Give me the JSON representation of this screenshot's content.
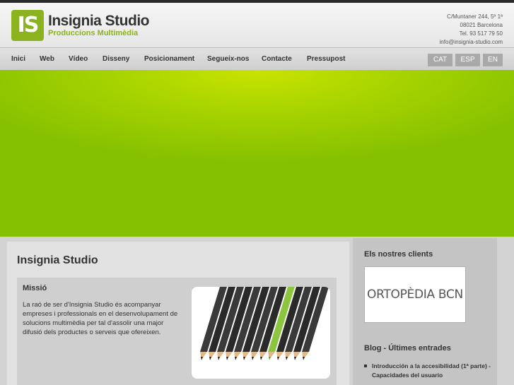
{
  "brand": {
    "logo_mark": "IS",
    "name": "Insignia Studio",
    "tagline": "Produccions Multimèdia",
    "accent": "#8ab31f"
  },
  "contact": {
    "line1": "C/Muntaner 244, 5º 1ª",
    "line2": "08021 Barcelona",
    "line3": "Tel. 93 517 79 50",
    "line4": "info@insignia-studio.com"
  },
  "nav": {
    "items": [
      "Inici",
      "Web",
      "Vídeo",
      "Disseny",
      "Posicionament",
      "Segueix-nos",
      "Contacte",
      "Pressupost"
    ],
    "languages": [
      "CAT",
      "ESP",
      "EN"
    ]
  },
  "hero": {
    "color": "#a8d400"
  },
  "main": {
    "title": "Insignia Studio",
    "mission_title": "Missió",
    "mission_text": "La raó de ser d'Insignia Studio és acompanyar empreses i professionals en el desenvolupament de solucions multimèdia per tal d'assolir una major difusió dels productes o serveis que ofereixen."
  },
  "sidebar": {
    "clients_title": "Els nostres clients",
    "client_logo": "ORTOPÈDIA BCN",
    "blog_title": "Blog - Últimes entrades",
    "blog_entry": "Introducción a la accesibilidad (1ª parte) - Capacidades del usuario"
  }
}
